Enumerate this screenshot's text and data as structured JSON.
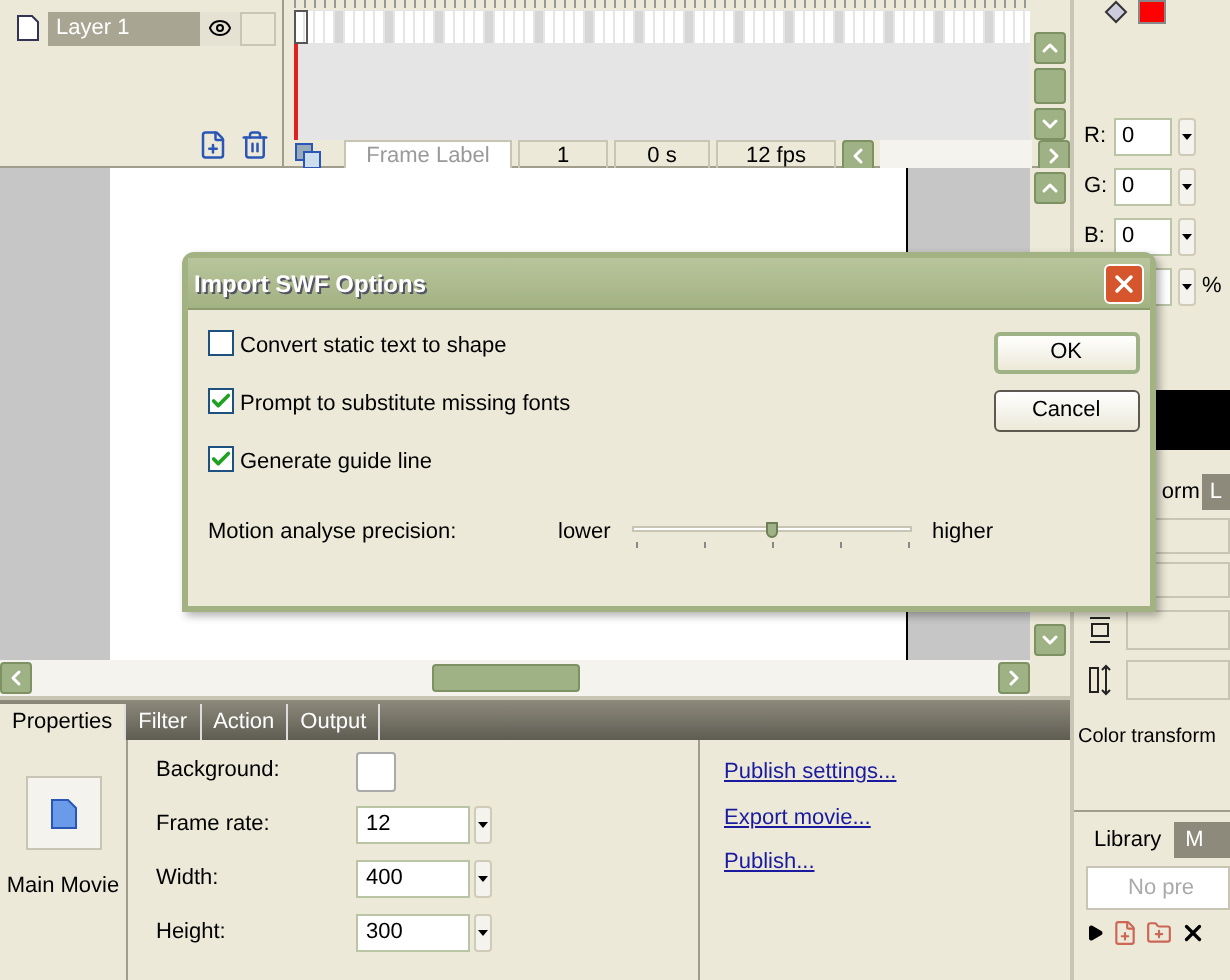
{
  "timeline": {
    "layers": [
      {
        "name": "Layer 1",
        "selected": true,
        "visible": true
      }
    ],
    "frame_label": "Frame Label",
    "current_frame": "1",
    "time": "0 s",
    "frame_rate": "12 fps"
  },
  "color_panel": {
    "channels": [
      {
        "label": "R:",
        "value": "0"
      },
      {
        "label": "G:",
        "value": "0"
      },
      {
        "label": "B:",
        "value": "0"
      },
      {
        "unit": "%"
      }
    ],
    "tabs": [
      {
        "label": "orm",
        "selected": true
      },
      {
        "label": "L",
        "selected": false
      }
    ],
    "color_transform_label": "Color transform"
  },
  "library": {
    "tabs": [
      {
        "label": "Library",
        "selected": true
      },
      {
        "label": "M",
        "selected": false
      }
    ],
    "preview": "No pre"
  },
  "properties": {
    "tabs": [
      {
        "label": "Properties",
        "selected": true
      },
      {
        "label": "Filter",
        "selected": false
      },
      {
        "label": "Action",
        "selected": false
      },
      {
        "label": "Output",
        "selected": false
      }
    ],
    "document_label": "Main Movie",
    "fields": [
      {
        "kind": "color",
        "label": "Background:"
      },
      {
        "kind": "dropdown",
        "label": "Frame rate:",
        "value": "12"
      },
      {
        "kind": "dropdown",
        "label": "Width:",
        "value": "400"
      },
      {
        "kind": "dropdown",
        "label": "Height:",
        "value": "300"
      }
    ],
    "links": [
      "Publish settings...",
      "Export movie...",
      "Publish..."
    ]
  },
  "dialog": {
    "title": "Import SWF Options",
    "options": [
      {
        "label": "Convert static text to shape",
        "checked": false
      },
      {
        "label": "Prompt to substitute missing fonts",
        "checked": true
      },
      {
        "label": "Generate guide line",
        "checked": true
      }
    ],
    "slider": {
      "label": "Motion analyse precision:",
      "min_label": "lower",
      "max_label": "higher",
      "level": 0.5
    },
    "buttons": [
      {
        "label": "OK",
        "default": true
      },
      {
        "label": "Cancel",
        "default": false
      }
    ]
  }
}
